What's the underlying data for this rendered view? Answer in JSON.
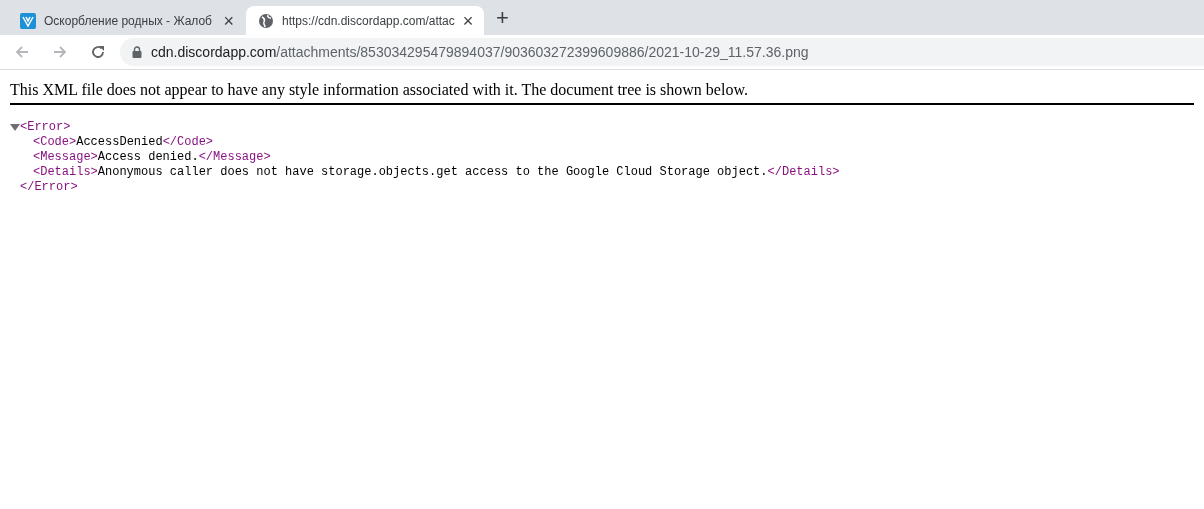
{
  "tabs": [
    {
      "kind": "site",
      "title": "Оскорбление родных - Жалоб",
      "selected": false,
      "close": "×"
    },
    {
      "kind": "globe",
      "title": "https://cdn.discordapp.com/attac",
      "selected": true,
      "close": "×"
    }
  ],
  "new_tab": "+",
  "address_bar": {
    "host": "cdn.discordapp.com",
    "path": "/attachments/853034295479894037/903603272399609886/2021-10-29_11.57.36.png"
  },
  "notice": "This XML file does not appear to have any style information associated with it. The document tree is shown below.",
  "xml_tree": {
    "expanded": true,
    "open_tag": "<Error>",
    "close_tag": "</Error>",
    "children": [
      {
        "open_tag": "<Code>",
        "text": "AccessDenied",
        "close_tag": "</Code>"
      },
      {
        "open_tag": "<Message>",
        "text": "Access denied.",
        "close_tag": "</Message>"
      },
      {
        "open_tag": "<Details>",
        "text": "Anonymous caller does not have storage.objects.get access to the Google Cloud Storage object.",
        "close_tag": "</Details>"
      }
    ]
  }
}
